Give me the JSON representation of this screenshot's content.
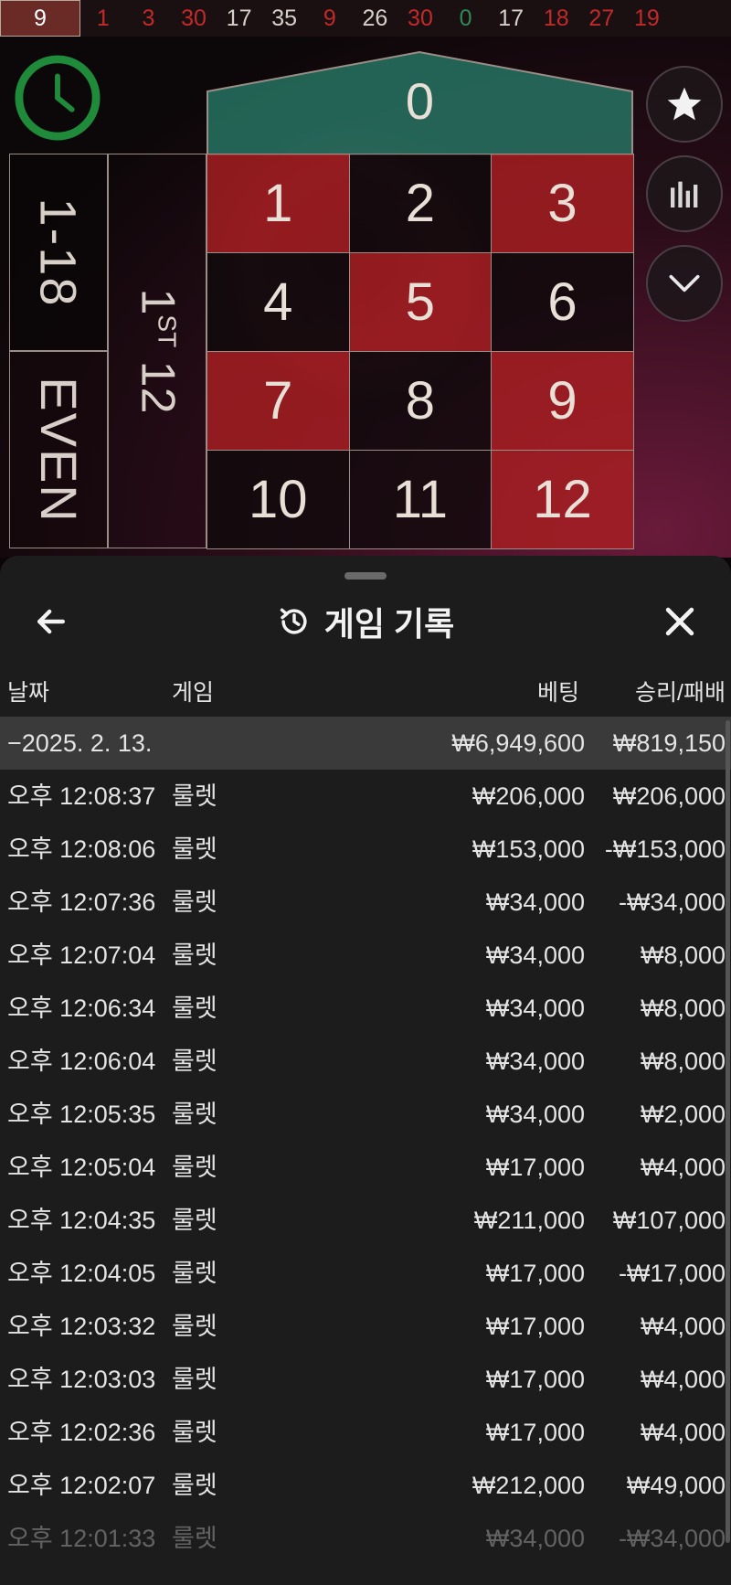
{
  "history_strip": [
    {
      "value": "9",
      "color": "red"
    },
    {
      "value": "1",
      "color": "red"
    },
    {
      "value": "3",
      "color": "red"
    },
    {
      "value": "30",
      "color": "red"
    },
    {
      "value": "17",
      "color": "black"
    },
    {
      "value": "35",
      "color": "black"
    },
    {
      "value": "9",
      "color": "red"
    },
    {
      "value": "26",
      "color": "black"
    },
    {
      "value": "30",
      "color": "red"
    },
    {
      "value": "0",
      "color": "green"
    },
    {
      "value": "17",
      "color": "black"
    },
    {
      "value": "18",
      "color": "red"
    },
    {
      "value": "27",
      "color": "red"
    },
    {
      "value": "19",
      "color": "red"
    }
  ],
  "table": {
    "zero": "0",
    "numbers": [
      {
        "value": "1",
        "color": "red"
      },
      {
        "value": "2",
        "color": "black"
      },
      {
        "value": "3",
        "color": "red"
      },
      {
        "value": "4",
        "color": "black"
      },
      {
        "value": "5",
        "color": "red"
      },
      {
        "value": "6",
        "color": "black"
      },
      {
        "value": "7",
        "color": "red"
      },
      {
        "value": "8",
        "color": "black"
      },
      {
        "value": "9",
        "color": "red"
      },
      {
        "value": "10",
        "color": "black"
      },
      {
        "value": "11",
        "color": "black"
      },
      {
        "value": "12",
        "color": "red"
      }
    ],
    "low_label": "1-18",
    "even_label": "EVEN",
    "dozen_label_num": "1",
    "dozen_label_sup": "ST",
    "dozen_label_rest": " 12"
  },
  "icons": {
    "timer": "timer-icon",
    "favorite": "star-icon",
    "stats": "bar-chart-icon",
    "collapse": "chevron-down-icon",
    "back": "arrow-left-icon",
    "history": "history-icon",
    "close": "close-icon"
  },
  "sheet": {
    "title": "게임 기록",
    "columns": {
      "date": "날짜",
      "game": "게임",
      "bet": "베팅",
      "winloss": "승리/패배"
    },
    "summary": {
      "date": "−2025. 2. 13.",
      "bet": "₩6,949,600",
      "winloss": "₩819,150"
    },
    "rows": [
      {
        "time": "오후 12:08:37",
        "game": "룰렛",
        "bet": "₩206,000",
        "winloss": "₩206,000"
      },
      {
        "time": "오후 12:08:06",
        "game": "룰렛",
        "bet": "₩153,000",
        "winloss": "-₩153,000"
      },
      {
        "time": "오후 12:07:36",
        "game": "룰렛",
        "bet": "₩34,000",
        "winloss": "-₩34,000"
      },
      {
        "time": "오후 12:07:04",
        "game": "룰렛",
        "bet": "₩34,000",
        "winloss": "₩8,000"
      },
      {
        "time": "오후 12:06:34",
        "game": "룰렛",
        "bet": "₩34,000",
        "winloss": "₩8,000"
      },
      {
        "time": "오후 12:06:04",
        "game": "룰렛",
        "bet": "₩34,000",
        "winloss": "₩8,000"
      },
      {
        "time": "오후 12:05:35",
        "game": "룰렛",
        "bet": "₩34,000",
        "winloss": "₩2,000"
      },
      {
        "time": "오후 12:05:04",
        "game": "룰렛",
        "bet": "₩17,000",
        "winloss": "₩4,000"
      },
      {
        "time": "오후 12:04:35",
        "game": "룰렛",
        "bet": "₩211,000",
        "winloss": "₩107,000"
      },
      {
        "time": "오후 12:04:05",
        "game": "룰렛",
        "bet": "₩17,000",
        "winloss": "-₩17,000"
      },
      {
        "time": "오후 12:03:32",
        "game": "룰렛",
        "bet": "₩17,000",
        "winloss": "₩4,000"
      },
      {
        "time": "오후 12:03:03",
        "game": "룰렛",
        "bet": "₩17,000",
        "winloss": "₩4,000"
      },
      {
        "time": "오후 12:02:36",
        "game": "룰렛",
        "bet": "₩17,000",
        "winloss": "₩4,000"
      },
      {
        "time": "오후 12:02:07",
        "game": "룰렛",
        "bet": "₩212,000",
        "winloss": "₩49,000"
      },
      {
        "time": "오후 12:01:33",
        "game": "룰렛",
        "bet": "₩34,000",
        "winloss": "-₩34,000"
      }
    ]
  }
}
